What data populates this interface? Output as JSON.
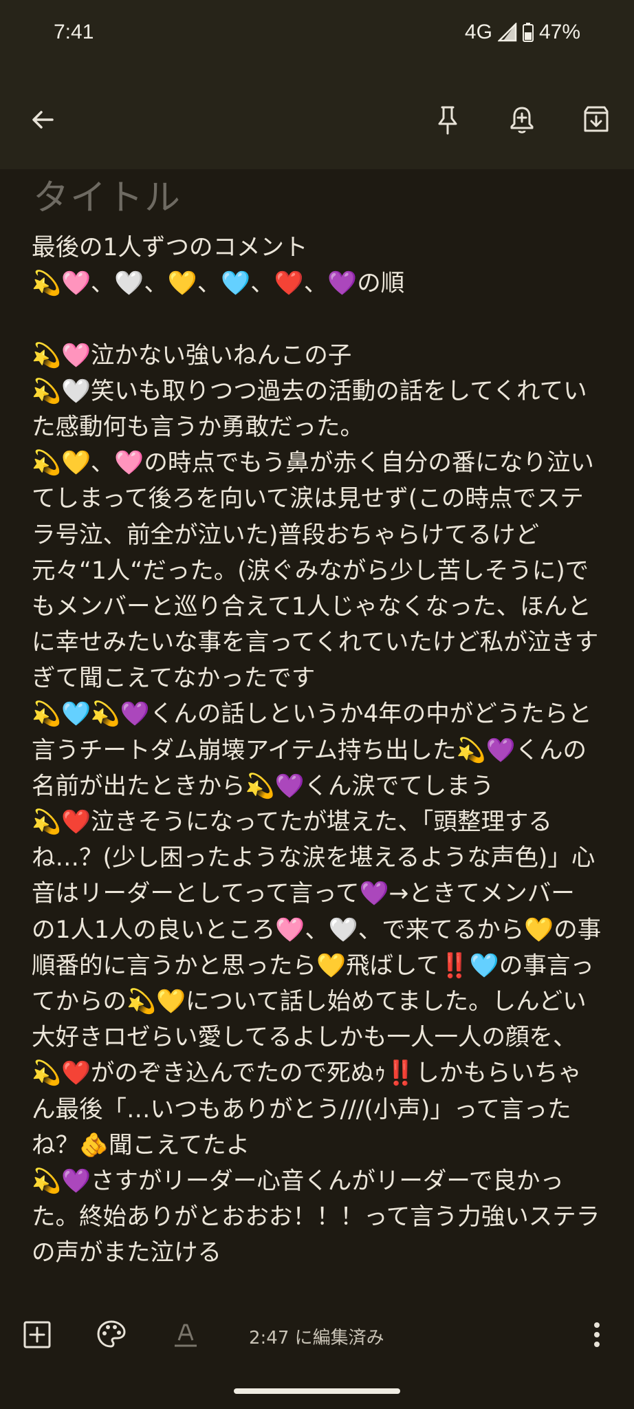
{
  "status_bar": {
    "time": "7:41",
    "network": "4G",
    "battery": "47%"
  },
  "toolbar": {
    "icons": [
      "back-arrow-icon",
      "pin-icon",
      "reminder-bell-icon",
      "archive-icon"
    ]
  },
  "note": {
    "title_placeholder": "タイトル",
    "lines": [
      "最後の1人ずつのコメント",
      "💫🩷、🤍、💛、🩵、❤️、💜の順",
      "",
      "💫🩷泣かない強いねんこの子",
      "💫🤍笑いも取りつつ過去の活動の話をしてくれてい",
      "た感動何も言うか勇敢だった。",
      "💫💛、🩷の時点でもう鼻が赤く自分の番になり泣い",
      "てしまって後ろを向いて涙は見せず(この時点でステ",
      "ラ号泣、前全が泣いた)普段おちゃらけてるけど",
      "元々“1人“だった。(涙ぐみながら少し苦しそうに)で",
      "もメンバーと巡り合えて1人じゃなくなった、ほんと",
      "に幸せみたいな事を言ってくれていたけど私が泣きす",
      "ぎて聞こえてなかったです",
      "💫🩵💫💜くんの話しというか4年の中がどうたらと",
      "言うチートダム崩壊アイテム持ち出した💫💜くんの",
      "名前が出たときから💫💜くん涙でてしまう",
      "💫❤️泣きそうになってたが堪えた、「頭整理する",
      "ね…？(少し困ったような涙を堪えるような声色)」心",
      "音はリーダーとしてって言って💜→ときてメンバー",
      "の1人1人の良いところ🩷、🤍、で来てるから💛の事",
      "順番的に言うかと思ったら💛飛ばして‼️🩵の事言っ",
      "てからの💫💛について話し始めてました。しんどい",
      "大好きロゼらい愛してるよしかも一人一人の顔を、",
      "💫❤️がのぞき込んでたので死ぬｩ‼️しかもらいちゃ",
      "ん最後「…いつもありがとう///(小声)」って言った",
      "ね？🫵聞こえてたよ",
      "💫💜さすがリーダー心音くんがリーダーで良かっ",
      "た。終始ありがとおおお！！！って言う力強いステラ",
      "の声がまた泣ける"
    ]
  },
  "bottom_bar": {
    "edited_label": "2:47 に編集済み",
    "icons": [
      "add-box-icon",
      "palette-icon",
      "text-format-icon",
      "more-vert-icon"
    ]
  }
}
